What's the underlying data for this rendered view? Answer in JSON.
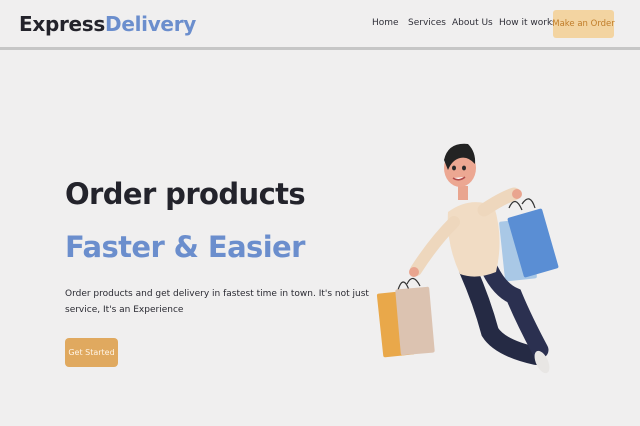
{
  "logo": {
    "part1": "Express",
    "part2": "Delivery"
  },
  "nav": {
    "home": "Home",
    "services": "Services",
    "about": "About Us",
    "how": "How it works",
    "cta": "Make an Order"
  },
  "hero": {
    "title_plain": "Order products ",
    "title_accent": "Faster & Easier",
    "text": "Order products and get delivery in fastest time in town. It's not just service, It's an Experience",
    "button": "Get Started"
  },
  "colors": {
    "accent_blue": "#6b8ecd",
    "button_orange": "#e0a95f",
    "nav_cta_bg": "#f3d4a1",
    "background": "#f0efef"
  }
}
